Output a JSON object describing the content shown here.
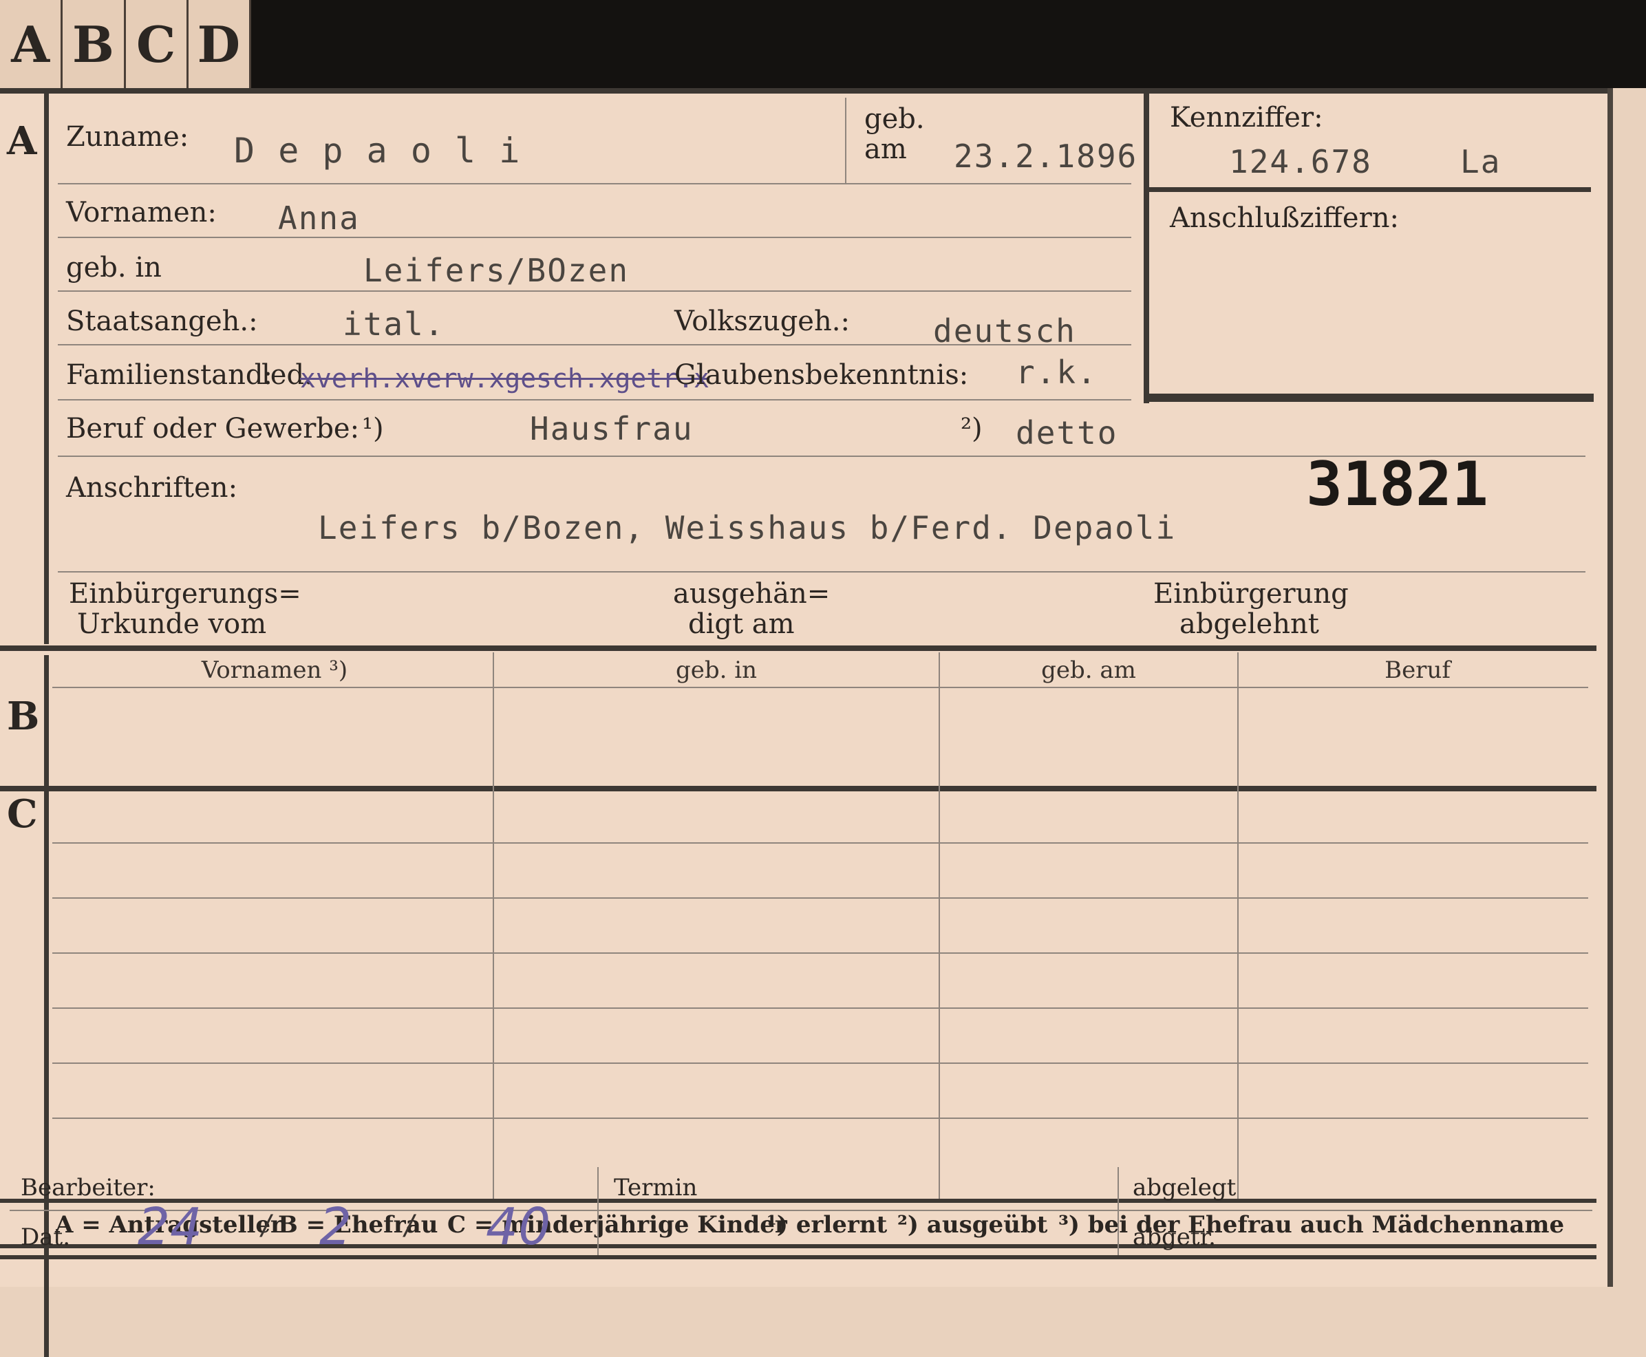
{
  "tabs": [
    "A",
    "B",
    "C",
    "D"
  ],
  "sections": {
    "a": "A",
    "b": "B",
    "c": "C"
  },
  "labels": {
    "zuname": "Zuname:",
    "geb": "geb.",
    "am": "am",
    "vornamen": "Vornamen:",
    "geb_in": "geb. in",
    "staatsangeh": "Staatsangeh.:",
    "volkszugeh": "Volkszugeh.:",
    "familienstand": "Familienstand:",
    "familienstand_options": "led.",
    "glaubensbekenntnis": "Glaubensbekenntnis:",
    "beruf": "Beruf oder Gewerbe:",
    "note1": "¹)",
    "note2": "²)",
    "anschriften": "Anschriften:",
    "einbuergerungs_line1": "Einbürgerungs=",
    "einbuergerungs_line2": "Urkunde vom",
    "ausgehaen_line1": "ausgehän=",
    "ausgehaen_line2": "digt am",
    "einbuergerung_line1": "Einbürgerung",
    "einbuergerung_line2": "abgelehnt",
    "kennziffer": "Kennziffer:",
    "anschlussziffern": "Anschlußziffern:"
  },
  "values": {
    "zuname": "D e p a o l i",
    "geb_am": "23.2.1896",
    "kennziffer": "124.678",
    "kennziffer_suffix": "La",
    "vornamen": "Anna",
    "geb_in": "Leifers/BOzen",
    "staatsangeh": "ital.",
    "volkszugeh": "deutsch",
    "familienstand_struck": "xverh.xverw.xgesch.xgetr.x",
    "glaubensbekenntnis": "r.k.",
    "beruf_erlernt": "Hausfrau",
    "beruf_ausgeuebt": "detto",
    "card_number": "31821",
    "anschrift": "Leifers b/Bozen, Weisshaus  b/Ferd. Depaoli"
  },
  "table_headers": [
    "Vornamen ³)",
    "geb. in",
    "geb. am",
    "Beruf"
  ],
  "footer_legend": {
    "a": "A = Antragsteller",
    "b": "B = Ehefrau",
    "c": "C = minderjährige Kinder",
    "n1": "¹) erlernt",
    "n2": "²) ausgeübt",
    "n3": "³) bei der Ehefrau auch Mädchenname"
  },
  "bottom": {
    "bearbeiter": "Bearbeiter:",
    "dat": "Dat.",
    "termin": "Termin",
    "abgelegt": "abgelegt",
    "abgetr": "abgetr.",
    "date_day": "24",
    "date_sep1": "/",
    "date_month": "2",
    "date_sep2": "/",
    "date_year": "40"
  }
}
